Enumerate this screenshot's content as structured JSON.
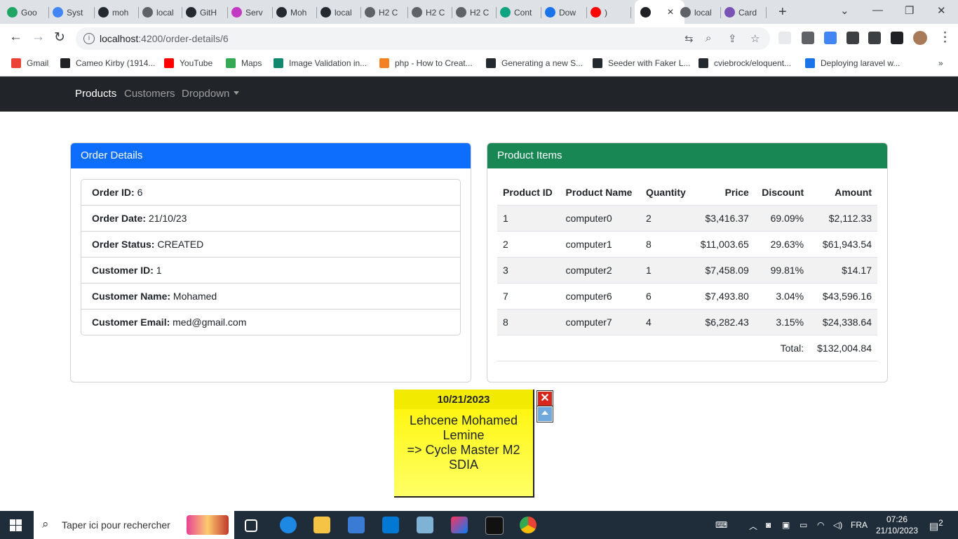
{
  "browser": {
    "tabs": [
      {
        "title": "Goo",
        "icon": "google-drive-icon",
        "color": "#1fa463"
      },
      {
        "title": "Syst",
        "icon": "system-icon",
        "color": "#4285f4"
      },
      {
        "title": "moh",
        "icon": "github-icon",
        "color": "#24292f"
      },
      {
        "title": "local",
        "icon": "globe-icon",
        "color": "#5f6368"
      },
      {
        "title": "GitH",
        "icon": "github-icon",
        "color": "#24292f"
      },
      {
        "title": "Serv",
        "icon": "service-icon",
        "color": "#c13ac1"
      },
      {
        "title": "Moh",
        "icon": "github-icon",
        "color": "#24292f"
      },
      {
        "title": "local",
        "icon": "vite-icon",
        "color": "#24292f"
      },
      {
        "title": "H2 C",
        "icon": "globe-icon",
        "color": "#5f6368"
      },
      {
        "title": "H2 C",
        "icon": "globe-icon",
        "color": "#5f6368"
      },
      {
        "title": "H2 C",
        "icon": "globe-icon",
        "color": "#5f6368"
      },
      {
        "title": "Cont",
        "icon": "chatgpt-icon",
        "color": "#10a37f"
      },
      {
        "title": "Dow",
        "icon": "download-icon",
        "color": "#1a73e8"
      },
      {
        "title": ")",
        "icon": "youtube-icon",
        "color": "#ff0000"
      },
      {
        "title": "",
        "icon": "angular-icon",
        "color": "#202124",
        "active": true
      },
      {
        "title": "local",
        "icon": "globe-icon",
        "color": "#5f6368"
      },
      {
        "title": "Card",
        "icon": "bootstrap-icon",
        "color": "#7952b3"
      }
    ],
    "url_host": "localhost",
    "url_path": ":4200/order-details/6",
    "bookmarks": [
      {
        "label": "Gmail",
        "icon": "gmail-icon",
        "color": "#ea4335"
      },
      {
        "label": "Cameo Kirby (1914...",
        "icon": "d-icon",
        "color": "#202124"
      },
      {
        "label": "YouTube",
        "icon": "youtube-icon",
        "color": "#ff0000"
      },
      {
        "label": "Maps",
        "icon": "maps-icon",
        "color": "#34a853"
      },
      {
        "label": "Image Validation in...",
        "icon": "ns-icon",
        "color": "#12876f"
      },
      {
        "label": "php - How to Creat...",
        "icon": "stackoverflow-icon",
        "color": "#f48024"
      },
      {
        "label": "Generating a new S...",
        "icon": "github-icon",
        "color": "#24292f"
      },
      {
        "label": "Seeder with Faker L...",
        "icon": "site-icon",
        "color": "#24292f"
      },
      {
        "label": "cviebrock/eloquent...",
        "icon": "github-icon",
        "color": "#24292f"
      },
      {
        "label": "Deploying laravel w...",
        "icon": "deploy-icon",
        "color": "#1a73e8"
      }
    ]
  },
  "nav": {
    "products": "Products",
    "customers": "Customers",
    "dropdown": "Dropdown"
  },
  "order_card": {
    "title": "Order Details",
    "header_color": "#0d6efd",
    "fields": [
      {
        "label": "Order ID:",
        "value": "6"
      },
      {
        "label": "Order Date:",
        "value": "21/10/23"
      },
      {
        "label": "Order Status:",
        "value": "CREATED"
      },
      {
        "label": "Customer ID:",
        "value": "1"
      },
      {
        "label": "Customer Name:",
        "value": "Mohamed"
      },
      {
        "label": "Customer Email:",
        "value": "med@gmail.com"
      }
    ]
  },
  "items_card": {
    "title": "Product Items",
    "header_color": "#198754",
    "columns": [
      "Product ID",
      "Product Name",
      "Quantity",
      "Price",
      "Discount",
      "Amount"
    ],
    "rows": [
      [
        "1",
        "computer0",
        "2",
        "$3,416.37",
        "69.09%",
        "$2,112.33"
      ],
      [
        "2",
        "computer1",
        "8",
        "$11,003.65",
        "29.63%",
        "$61,943.54"
      ],
      [
        "3",
        "computer2",
        "1",
        "$7,458.09",
        "99.81%",
        "$14.17"
      ],
      [
        "7",
        "computer6",
        "6",
        "$7,493.80",
        "3.04%",
        "$43,596.16"
      ],
      [
        "8",
        "computer7",
        "4",
        "$6,282.43",
        "3.15%",
        "$24,338.64"
      ]
    ],
    "total_label": "Total:",
    "total_value": "$132,004.84"
  },
  "sticky": {
    "date": "10/21/2023",
    "line1": "Lehcene Mohamed",
    "line2": "Lemine",
    "line3": "=> Cycle Master M2",
    "line4": "SDIA",
    "close": "✕"
  },
  "taskbar": {
    "search_placeholder": "Taper ici pour rechercher",
    "lang": "FRA",
    "time": "07:26",
    "date": "21/10/2023",
    "notifications": "2"
  }
}
